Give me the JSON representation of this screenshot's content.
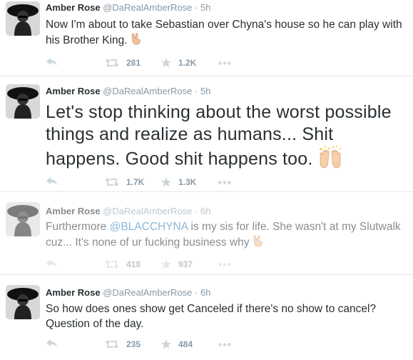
{
  "tweets": [
    {
      "name": "Amber Rose",
      "handle": "@DaRealAmberRose",
      "separator": "·",
      "time": "5h",
      "text": "Now I'm about to take Sebastian over Chyna's house so he can play with his Brother King.",
      "emoji": "victory-hand",
      "retweets": "281",
      "favorites": "1.2K"
    },
    {
      "name": "Amber Rose",
      "handle": "@DaRealAmberRose",
      "separator": "·",
      "time": "5h",
      "text": "Let's stop thinking about the worst possible things and realize as humans... Shit happens. Good shit happens too.",
      "emoji": "raising-hands",
      "retweets": "1.7K",
      "favorites": "1.3K"
    },
    {
      "name": "Amber Rose",
      "handle": "@DaRealAmberRose",
      "separator": "·",
      "time": "6h",
      "text_before": "Furthermore ",
      "mention": "@BLACCHYNA",
      "text_after": " is my sis for life. She wasn't at my Slutwalk cuz... It's none of ur fucking business why",
      "emoji": "victory-hand",
      "retweets": "418",
      "favorites": "937"
    },
    {
      "name": "Amber Rose",
      "handle": "@DaRealAmberRose",
      "separator": "·",
      "time": "6h",
      "text": "So how does ones show get Canceled if there's no show to cancel? Question of the day.",
      "retweets": "235",
      "favorites": "484"
    }
  ],
  "icons": {
    "reply": "reply-icon",
    "retweet": "retweet-icon",
    "favorite": "star-icon",
    "more": "more-dots-icon"
  },
  "colors": {
    "link": "#2b7bb9",
    "muted": "#8899a6",
    "text": "#292f33",
    "divider": "#e1e8ed"
  }
}
